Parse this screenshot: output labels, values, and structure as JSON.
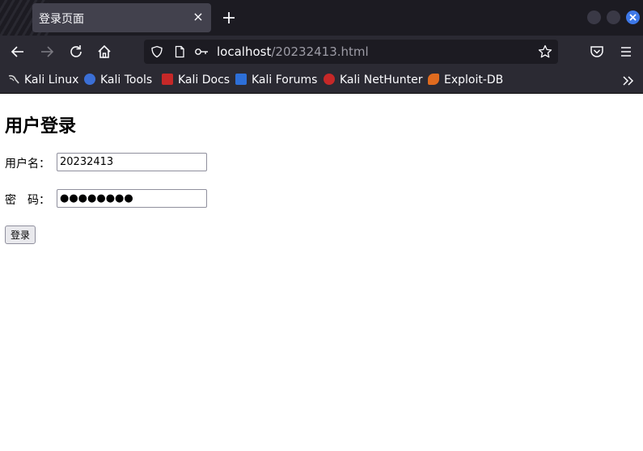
{
  "tab": {
    "title": "登录页面",
    "close_glyph": "×",
    "new_tab_icon": "plus-icon"
  },
  "window_controls": [
    "minimize-icon",
    "maximize-icon",
    "close-icon"
  ],
  "nav": {
    "back_icon": "back-arrow-icon",
    "forward_icon": "forward-arrow-icon",
    "reload_icon": "reload-icon",
    "home_icon": "home-icon",
    "url_host": "localhost",
    "url_path": "/20232413.html",
    "pocket_icon": "pocket-icon",
    "menu_icon": "hamburger-menu-icon"
  },
  "bookmarks": [
    {
      "label": "Kali Linux",
      "color": "#d0d0d0"
    },
    {
      "label": "Kali Tools",
      "color": "#3b6fd6"
    },
    {
      "label": "Kali Docs",
      "color": "#c62828"
    },
    {
      "label": "Kali Forums",
      "color": "#2d6fd8"
    },
    {
      "label": "Kali NetHunter",
      "color": "#c62828"
    },
    {
      "label": "Exploit-DB",
      "color": "#e06b1f"
    }
  ],
  "page": {
    "heading": "用户登录",
    "username_label": "用户名：",
    "username_value": "20232413",
    "password_label": "密　码：",
    "password_value": "●●●●●●●●",
    "login_button": "登录"
  },
  "colors": {
    "tabstrip_bg": "#1c1b22",
    "toolbar_bg": "#2b2a33",
    "tab_active_bg": "#42414d",
    "window_close": "#3d78e8"
  }
}
